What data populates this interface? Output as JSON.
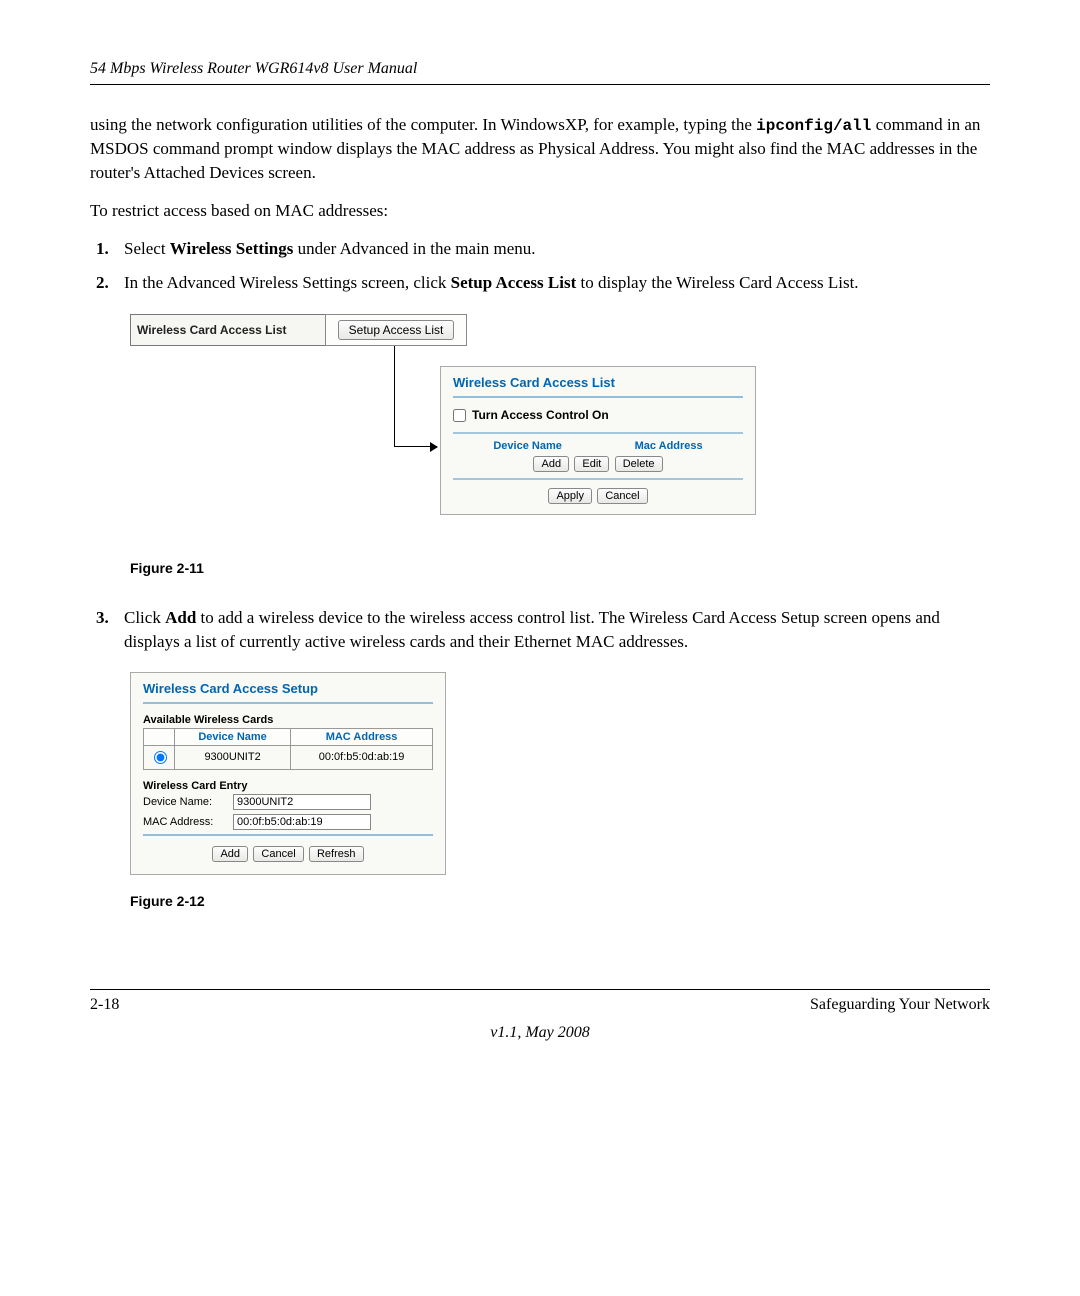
{
  "header": {
    "title": "54 Mbps Wireless Router WGR614v8 User Manual"
  },
  "intro": {
    "part1": "using the network configuration utilities of the computer. In WindowsXP, for example, typing the ",
    "command": "ipconfig/all",
    "part2": " command in an MSDOS command prompt window displays the MAC address as Physical Address. You might also find the MAC addresses in the router's Attached Devices screen.",
    "restrict": "To restrict access based on MAC addresses:"
  },
  "steps": {
    "one": {
      "num": "1.",
      "pre": "Select ",
      "bold": "Wireless Settings",
      "post": " under Advanced in the main menu."
    },
    "two": {
      "num": "2.",
      "pre": "In the Advanced Wireless Settings screen, click ",
      "bold": "Setup Access List",
      "post": " to display the Wireless Card Access List."
    },
    "three": {
      "num": "3.",
      "pre": "Click ",
      "bold": "Add",
      "post": " to add a wireless device to the wireless access control list. The Wireless Card Access Setup screen opens and displays a list of currently active wireless cards and their Ethernet MAC addresses."
    }
  },
  "fig211": {
    "caption": "Figure 2-11",
    "box_label": "Wireless Card Access List",
    "setup_button": "Setup Access List",
    "panel": {
      "title": "Wireless Card Access List",
      "checkbox_label": "Turn Access Control On",
      "col_device": "Device Name",
      "col_mac": "Mac Address",
      "btn_add": "Add",
      "btn_edit": "Edit",
      "btn_delete": "Delete",
      "btn_apply": "Apply",
      "btn_cancel": "Cancel"
    }
  },
  "fig212": {
    "caption": "Figure 2-12",
    "panel": {
      "title": "Wireless Card Access Setup",
      "available_heading": "Available Wireless Cards",
      "col_device": "Device Name",
      "col_mac": "MAC Address",
      "row_device": "9300UNIT2",
      "row_mac": "00:0f:b5:0d:ab:19",
      "entry_heading": "Wireless Card Entry",
      "label_device": "Device Name:",
      "value_device": "9300UNIT2",
      "label_mac": "MAC Address:",
      "value_mac": "00:0f:b5:0d:ab:19",
      "btn_add": "Add",
      "btn_cancel": "Cancel",
      "btn_refresh": "Refresh"
    }
  },
  "footer": {
    "page_num": "2-18",
    "section": "Safeguarding Your Network",
    "version": "v1.1, May 2008"
  }
}
